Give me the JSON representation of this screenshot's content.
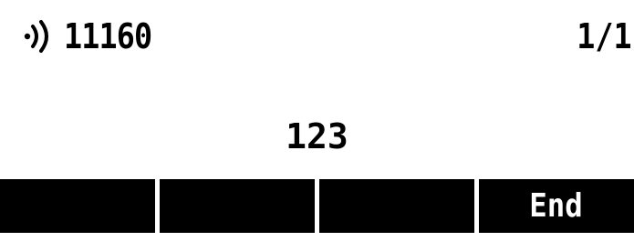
{
  "status": {
    "line_number": "11160",
    "page_indicator": "1/1",
    "icon": "signal-icon"
  },
  "dialed": {
    "number": "123"
  },
  "softkeys": [
    {
      "label": ""
    },
    {
      "label": ""
    },
    {
      "label": ""
    },
    {
      "label": "End"
    }
  ],
  "colors": {
    "background": "#ffffff",
    "foreground": "#000000",
    "softkey_bg": "#000000",
    "softkey_text": "#ffffff"
  }
}
